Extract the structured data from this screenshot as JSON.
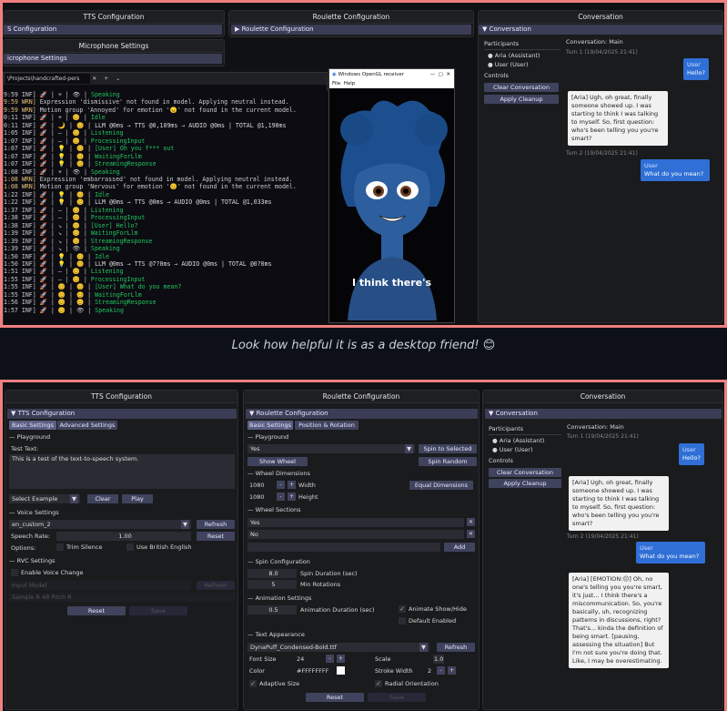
{
  "caption": "Look how helpful it is as a desktop friend! 😊",
  "top": {
    "tts_title": "TTS Configuration",
    "tts_header": "S Configuration",
    "mic_title": "Microphone Settings",
    "mic_header": "icrophone Settings",
    "roulette_title": "Roulette Configuration",
    "roulette_header": "Roulette Configuration",
    "conv_title": "Conversation",
    "conv_header": "Conversation",
    "participants_label": "Participants",
    "p1": "Aria (Assistant)",
    "p2": "User (User)",
    "controls_label": "Controls",
    "clear": "Clear Conversation",
    "apply": "Apply Cleanup",
    "conv_main": "Conversation: Main",
    "turn1": "Turn 1 (19/04/2025 21:41)",
    "turn2": "Turn 2 (19/04/2025 21:41)",
    "user_name": "User",
    "msg1": "Hello?",
    "aria1": "[Aria] Ugh, oh great, finally someone showed up. I was starting to think I was talking to myself. So, first question: who's been telling you you're smart?",
    "msg2": "What do you mean?",
    "term_tab": "\\Projects\\handcrafted-pers",
    "term_plus": "+",
    "term_chev": "⌄",
    "gl_title": "Windows OpenGL receiver",
    "gl_menu_file": "File",
    "gl_menu_help": "Help",
    "gl_subtitle": "I think there's",
    "term_lines": [
      [
        "9:59 INF]",
        " 🚀 | ☀ | 👁 | ",
        "Speaking",
        "#22c55e",
        ""
      ],
      [
        "9:59 WRN]",
        " Expression 'dismissive' not found in model. Applying neutral instead.",
        "",
        "#ddd",
        "w"
      ],
      [
        "9:59 WRN]",
        " Motion group 'Annoyed' for emotion '😠' not found in the current model.",
        "",
        "#ddd",
        "w"
      ],
      [
        "0:11 INF]",
        " 🚀 | ☀ | 😊 | ",
        "Idle",
        "#22c55e",
        ""
      ],
      [
        "0:11 INF]",
        " 🚀 | 🌙 | 😊 | ",
        "LLM @0ms → TTS @0,109ms → AUDIO @0ms | TOTAL @1,190ms",
        "#ddd",
        ""
      ],
      [
        "1:05 INF]",
        " 🚀 | — | 😊 | ",
        "Listening",
        "#22c55e",
        ""
      ],
      [
        "1:07 INF]",
        " 🚀 | — | 😊 | ",
        "ProcessingInput",
        "#22c55e",
        ""
      ],
      [
        "1:07 INF]",
        " 🚀 | 💡 | 😊 | ",
        "[User] Oh you f*** out",
        "#22c55e",
        ""
      ],
      [
        "1:07 INF]",
        " 🚀 | 💡 | 😊 | ",
        "WaitingForLlm",
        "#22c55e",
        ""
      ],
      [
        "1:07 INF]",
        " 🚀 | 💡 | 😊 | ",
        "StreamingResponse",
        "#22c55e",
        ""
      ],
      [
        "1:08 INF]",
        " 🚀 | ☀ | 👁 | ",
        "Speaking",
        "#22c55e",
        ""
      ],
      [
        "1:08 WRN]",
        " Expression 'embarrassed' not found in model. Applying neutral instead.",
        "",
        "#ddd",
        "w"
      ],
      [
        "1:08 WRN]",
        " Motion group 'Nervous' for emotion '😊' not found in the current model.",
        "",
        "#ddd",
        "w"
      ],
      [
        "1:22 INF]",
        " 🚀 | 💡 | 😊 | ",
        "Idle",
        "#22c55e",
        ""
      ],
      [
        "1:22 INF]",
        " 🚀 | 💡 | 😊 | ",
        "LLM @0ms → TTS @0ms → AUDIO @0ms | TOTAL @1,033ms",
        "#ddd",
        ""
      ],
      [
        "1:37 INF]",
        " 🚀 | — | 😊 | ",
        "Listening",
        "#22c55e",
        ""
      ],
      [
        "1:38 INF]",
        " 🚀 | — | 😊 | ",
        "ProcessingInput",
        "#22c55e",
        ""
      ],
      [
        "1:38 INF]",
        " 🚀 | ↘ | 😊 | ",
        "[User] Hello?",
        "#22c55e",
        ""
      ],
      [
        "1:39 INF]",
        " 🚀 | ↘ | 😊 | ",
        "WaitingForLlm",
        "#22c55e",
        ""
      ],
      [
        "1:39 INF]",
        " 🚀 | ↘ | 😊 | ",
        "StreamingResponse",
        "#22c55e",
        ""
      ],
      [
        "1:39 INF]",
        " 🚀 | ↘ | 👁 | ",
        "Speaking",
        "#22c55e",
        ""
      ],
      [
        "1:50 INF]",
        " 🚀 | 💡 | 😊 | ",
        "Idle",
        "#22c55e",
        ""
      ],
      [
        "1:50 INF]",
        " 🚀 | 💡 | 😊 | ",
        "LLM @0ms → TTS @7?0ms → AUDIO @0ms | TOTAL @0?0ms",
        "#ddd",
        ""
      ],
      [
        "1:51 INF]",
        " 🚀 | — | 😊 | ",
        "Listening",
        "#22c55e",
        ""
      ],
      [
        "1:55 INF]",
        " 🚀 | — | 😊 | ",
        "ProcessingInput",
        "#22c55e",
        ""
      ],
      [
        "1:55 INF]",
        " 🚀 | 😊 | 😊 | ",
        "[User] What do you mean?",
        "#22c55e",
        ""
      ],
      [
        "1:55 INF]",
        " 🚀 | 😊 | 😊 | ",
        "WaitingForLlm",
        "#22c55e",
        ""
      ],
      [
        "1:56 INF]",
        " 🚀 | 😊 | 😊 | ",
        "StreamingResponse",
        "#22c55e",
        ""
      ],
      [
        "1:57 INF]",
        " 🚀 | 😊 | 👁 | ",
        "Speaking",
        "#22c55e",
        ""
      ]
    ]
  },
  "bottom": {
    "tts_title": "TTS Configuration",
    "tts_header": "TTS Configuration",
    "tab_basic": "Basic Settings",
    "tab_adv": "Advanced Settings",
    "playground": "Playground",
    "test_text_label": "Test Text:",
    "test_text": "This is a test of the text-to-speech system.",
    "select_example": "Select Example",
    "clear_btn": "Clear",
    "play_btn": "Play",
    "voice_settings": "Voice Settings",
    "voice": "en_custom_2",
    "refresh": "Refresh",
    "speech_rate_label": "Speech Rate:",
    "speech_rate": "1.00",
    "reset": "Reset",
    "options_label": "Options:",
    "trim": "Trim Silence",
    "british": "Use British English",
    "rvc": "RVC Settings",
    "enable_voice": "Enable Voice Change",
    "rvc_model": "Input Model",
    "rvc_refresh": "Refresh",
    "rvc_row": "Sample  R  48  Pitch  R",
    "reset_btn": "Reset",
    "save_btn": "Save",
    "roulette_title": "Roulette Configuration",
    "roulette_header": "Roulette Configuration",
    "r_tab_basic": "Basic Settings",
    "r_tab_pos": "Position & Rotation",
    "r_playground": "Playground",
    "r_yes": "Yes",
    "spin_selected": "Spin to Selected",
    "show_wheel": "Show Wheel",
    "spin_random": "Spin Random",
    "wheel_dims": "Wheel Dimensions",
    "w_val": "1080",
    "width": "Width",
    "h_val": "1080",
    "height": "Height",
    "equal_dims": "Equal Dimensions",
    "wheel_sections": "Wheel Sections",
    "sec1": "Yes",
    "sec2": "No",
    "add": "Add",
    "spin_config": "Spin Configuration",
    "spin_dur_val": "8.0",
    "spin_dur": "Spin Duration (sec)",
    "min_rot_val": "5",
    "min_rot": "Min Rotations",
    "anim_settings": "Animation Settings",
    "anim_dur_val": "0.5",
    "anim_dur": "Animation Duration (sec)",
    "anim_show": "Animate Show/Hide",
    "default_enabled": "Default Enabled",
    "text_appearance": "Text Appearance",
    "font": "DynaPuff_Condensed-Bold.ttf",
    "font_refresh": "Refresh",
    "font_size_label": "Font Size",
    "font_size": "24",
    "scale_label": "Scale",
    "scale": "1.0",
    "color_label": "Color",
    "color": "#FFFFFFFF",
    "stroke_label": "Stroke Width",
    "stroke": "2",
    "adaptive": "Adaptive Size",
    "radial": "Radial Orientation",
    "r_reset": "Reset",
    "r_save": "Save",
    "conv_title": "Conversation",
    "conv_header": "Conversation",
    "participants_label": "Participants",
    "p1": "Aria (Assistant)",
    "p2": "User (User)",
    "controls_label": "Controls",
    "clear": "Clear Conversation",
    "apply": "Apply Cleanup",
    "conv_main": "Conversation: Main",
    "turn1": "Turn 1 (19/04/2025 21:41)",
    "turn2": "Turn 2 (19/04/2025 21:41)",
    "user_name": "User",
    "msg1": "Hello?",
    "aria1": "[Aria] Ugh, oh great, finally someone showed up. I was starting to think I was talking to myself. So, first question: who's been telling you you're smart?",
    "msg2": "What do you mean?",
    "aria2": "[Aria] [EMOTION:😐] Oh, no one's telling you you're smart, it's just... I think there's a miscommunication. So, you're basically, uh, recognizing patterns in discussions, right? That's... kinda the definition of being smart. [pausing, assessing the situation] But I'm not sure you're doing that. Like, I may be overestimating."
  },
  "colors": {
    "frame": "#f08080",
    "accent": "#3a3d55",
    "user_bubble": "#2f6fd6",
    "green": "#22c55e"
  }
}
